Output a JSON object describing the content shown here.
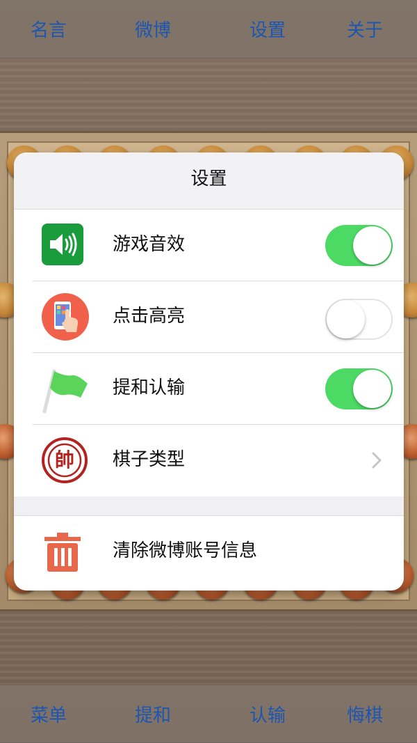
{
  "top_bar": {
    "items": [
      {
        "label": "名言"
      },
      {
        "label": "微博"
      },
      {
        "label": "设置"
      },
      {
        "label": "关于"
      }
    ]
  },
  "bottom_bar": {
    "items": [
      {
        "label": "菜单"
      },
      {
        "label": "提和"
      },
      {
        "label": "认输"
      },
      {
        "label": "悔棋"
      }
    ]
  },
  "dialog": {
    "title": "设置",
    "rows": [
      {
        "label": "游戏音效",
        "icon": "speaker-icon",
        "control": "toggle",
        "value": true
      },
      {
        "label": "点击高亮",
        "icon": "phone-tap-icon",
        "control": "toggle",
        "value": false
      },
      {
        "label": "提和认输",
        "icon": "green-flag-icon",
        "control": "toggle",
        "value": true
      },
      {
        "label": "棋子类型",
        "icon": "shuai-piece-icon",
        "control": "disclosure"
      }
    ],
    "piece_icon_char": "帥",
    "clear_row": {
      "label": "清除微博账号信息",
      "icon": "trash-icon"
    }
  },
  "colors": {
    "accent_text": "#1d56b0",
    "toggle_on": "#4cd964",
    "speaker_bg": "#1a9b3c",
    "trash": "#e8664a",
    "piece_red": "#b3231f"
  }
}
